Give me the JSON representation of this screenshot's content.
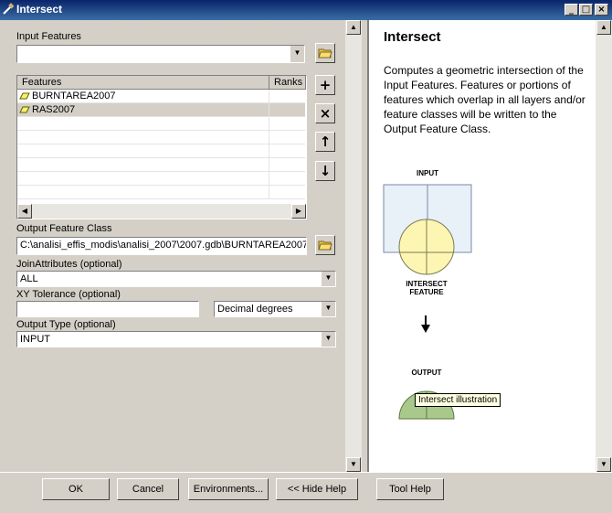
{
  "window": {
    "title": "Intersect",
    "controls": [
      "_",
      "□",
      "×"
    ]
  },
  "form": {
    "input_features_label": "Input Features",
    "input_features_value": "",
    "table_headers": [
      "Features",
      "Ranks"
    ],
    "table_rows": [
      {
        "feature": "BURNTAREA2007",
        "rank": "",
        "selected": false
      },
      {
        "feature": "RAS2007",
        "rank": "",
        "selected": true
      }
    ],
    "output_label": "Output Feature Class",
    "output_value": "C:\\analisi_effis_modis\\analisi_2007\\2007.gdb\\BURNTAREA2007_",
    "join_label": "JoinAttributes (optional)",
    "join_value": "ALL",
    "xy_label": "XY Tolerance (optional)",
    "xy_value": "",
    "xy_unit": "Decimal degrees",
    "type_label": "Output Type (optional)",
    "type_value": "INPUT"
  },
  "side_buttons": {
    "add": "+",
    "remove": "×",
    "up": "↑",
    "down": "↓"
  },
  "help": {
    "title": "Intersect",
    "description": "Computes a geometric intersection of the Input Features. Features or portions of features which overlap in all layers and/or feature classes will be written to the Output Feature Class.",
    "diagram_input_label": "INPUT",
    "diagram_intersect_label": "INTERSECT",
    "diagram_feature_label": "FEATURE",
    "diagram_output_label": "OUTPUT",
    "tooltip": "Intersect illustration"
  },
  "buttons": {
    "ok": "OK",
    "cancel": "Cancel",
    "environments": "Environments...",
    "hide_help": "<< Hide Help",
    "tool_help": "Tool Help"
  },
  "colors": {
    "title_bar": "#0a246a",
    "selected_row": "#d4d0c8",
    "diagram_input_fill": "#e8f0f8",
    "diagram_circle_fill": "#fdf6b3",
    "diagram_output_fill": "#a8c88c"
  }
}
